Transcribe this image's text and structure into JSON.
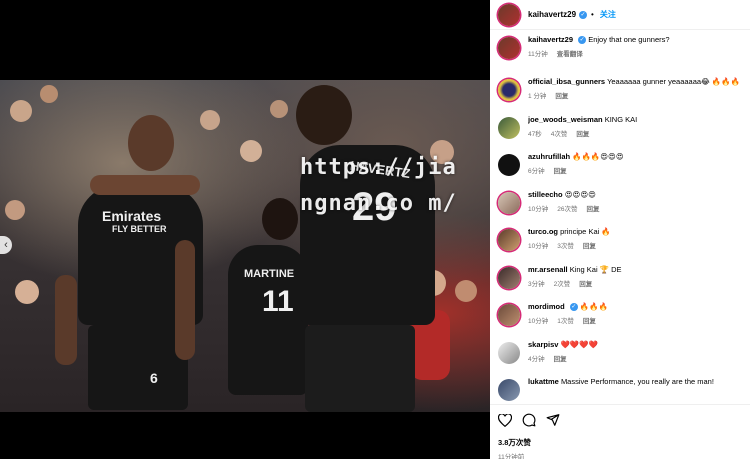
{
  "watermark": "https://jiangnan.co m/",
  "photo": {
    "shirt_sponsor_1": "Emirates",
    "shirt_sponsor_2": "FLY BETTER",
    "player_name_1": "MARTINE",
    "player_number_1": "11",
    "player_name_2": "HAVERTZ",
    "player_number_2": "29",
    "shorts_number": "6"
  },
  "colors": {
    "accent": "#0095f6",
    "verified": "#3897f0",
    "ring": "#d62976",
    "heart": "#ed4956"
  },
  "header": {
    "username": "kaihavertz29",
    "verified_icon": "verified-badge-icon",
    "separator": "•",
    "follow_label": "关注"
  },
  "caption": {
    "username": "kaihavertz29",
    "text": "Enjoy that one gunners?",
    "time": "11分钟",
    "translate_label": "查看翻译"
  },
  "comments": [
    {
      "user": "official_ibsa_gunners",
      "text": "Yeaaaaaa gunner yeaaaaaa😂 🔥🔥🔥",
      "time": "1 分钟",
      "likes": "",
      "reply": "回复"
    },
    {
      "user": "joe_woods_weisman",
      "text": "KING KAI",
      "time": "47秒",
      "likes": "4次赞",
      "reply": "回复"
    },
    {
      "user": "azuhrufillah",
      "text": "🔥🔥🔥😍😍😍",
      "time": "6分钟",
      "likes": "",
      "reply": "回复"
    },
    {
      "user": "stilleecho",
      "text": "😍😍😍😍",
      "time": "10分钟",
      "likes": "26次赞",
      "reply": "回复"
    },
    {
      "user": "turco.og",
      "text": "principe Kai 🔥",
      "time": "10分钟",
      "likes": "3次赞",
      "reply": "回复"
    },
    {
      "user": "mr.arsenall",
      "text": "King Kai 🏆 DE",
      "time": "3分钟",
      "likes": "2次赞",
      "reply": "回复"
    },
    {
      "user": "mordimod",
      "text": "🔥🔥🔥",
      "time": "10分钟",
      "likes": "1次赞",
      "reply": "回复"
    },
    {
      "user": "skarpisv",
      "text": "❤️❤️❤️❤️",
      "time": "4分钟",
      "likes": "",
      "reply": "回复"
    },
    {
      "user": "lukattme",
      "text": "Massive Performance, you really are the man!",
      "time": "",
      "likes": "",
      "reply": ""
    }
  ],
  "actions": {
    "like_icon": "heart-icon",
    "comment_icon": "comment-icon",
    "share_icon": "share-icon",
    "likes_count": "3.8万次赞",
    "post_time": "11分钟前"
  }
}
